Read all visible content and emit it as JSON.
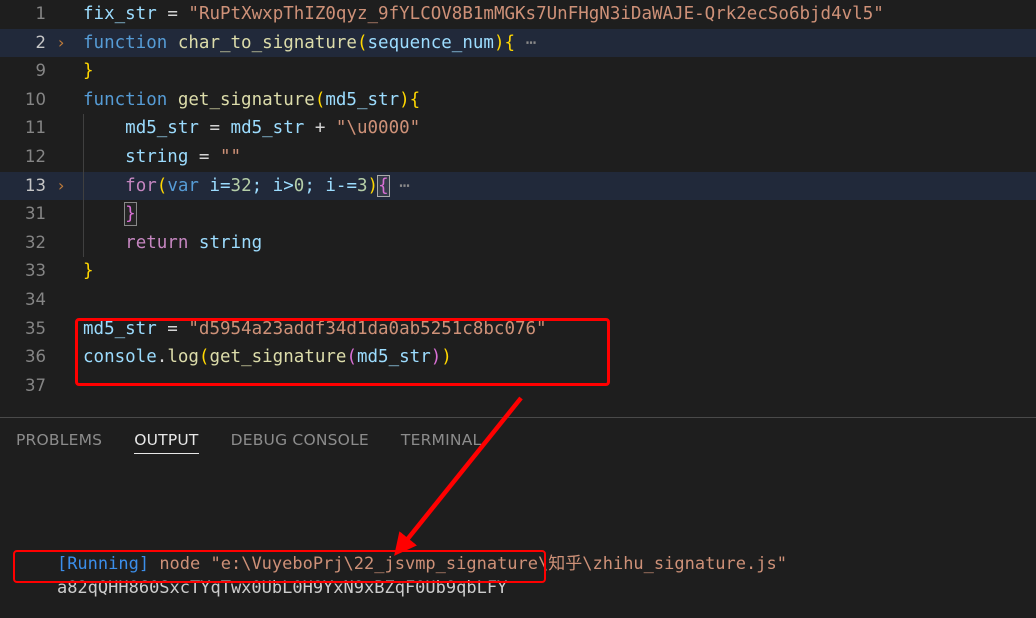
{
  "editor": {
    "lines": [
      {
        "number": "1",
        "fold": "",
        "active": false,
        "indent": 0,
        "tokens": [
          {
            "t": "fix_str",
            "c": "t-var"
          },
          {
            "t": " ",
            "c": "t-plain"
          },
          {
            "t": "=",
            "c": "t-punct"
          },
          {
            "t": " ",
            "c": "t-plain"
          },
          {
            "t": "\"RuPtXwxpThIZ0qyz_9fYLCOV8B1mMGKs7UnFHgN3iDaWAJE-Qrk2ecSo6bjd4vl5\"",
            "c": "t-str"
          }
        ]
      },
      {
        "number": "2",
        "fold": "chevron-right-icon",
        "active": true,
        "indent": 0,
        "tokens": [
          {
            "t": "function",
            "c": "t-kw"
          },
          {
            "t": " ",
            "c": "t-plain"
          },
          {
            "t": "char_to_signature",
            "c": "t-fn"
          },
          {
            "t": "(",
            "c": "t-paren1"
          },
          {
            "t": "sequence_num",
            "c": "t-var"
          },
          {
            "t": ")",
            "c": "t-paren1"
          },
          {
            "t": "{",
            "c": "t-paren1"
          },
          {
            "t": " ⋯",
            "c": "t-dots"
          }
        ]
      },
      {
        "number": "9",
        "fold": "",
        "active": false,
        "indent": 0,
        "tokens": [
          {
            "t": "}",
            "c": "t-paren1"
          }
        ]
      },
      {
        "number": "10",
        "fold": "",
        "active": false,
        "indent": 0,
        "tokens": [
          {
            "t": "function",
            "c": "t-kw"
          },
          {
            "t": " ",
            "c": "t-plain"
          },
          {
            "t": "get_signature",
            "c": "t-fn"
          },
          {
            "t": "(",
            "c": "t-paren1"
          },
          {
            "t": "md5_str",
            "c": "t-var"
          },
          {
            "t": ")",
            "c": "t-paren1"
          },
          {
            "t": "{",
            "c": "t-paren1"
          }
        ]
      },
      {
        "number": "11",
        "fold": "",
        "active": false,
        "indent": 1,
        "tokens": [
          {
            "t": "    ",
            "c": "t-plain"
          },
          {
            "t": "md5_str",
            "c": "t-var"
          },
          {
            "t": " = ",
            "c": "t-punct"
          },
          {
            "t": "md5_str",
            "c": "t-var"
          },
          {
            "t": " + ",
            "c": "t-punct"
          },
          {
            "t": "\"\\u0000\"",
            "c": "t-str"
          }
        ]
      },
      {
        "number": "12",
        "fold": "",
        "active": false,
        "indent": 1,
        "tokens": [
          {
            "t": "    ",
            "c": "t-plain"
          },
          {
            "t": "string",
            "c": "t-var"
          },
          {
            "t": " = ",
            "c": "t-punct"
          },
          {
            "t": "\"\"",
            "c": "t-str"
          }
        ]
      },
      {
        "number": "13",
        "fold": "chevron-right-icon",
        "active": true,
        "indent": 1,
        "tokens": [
          {
            "t": "    ",
            "c": "t-plain"
          },
          {
            "t": "for",
            "c": "t-kw2"
          },
          {
            "t": "(",
            "c": "t-paren1"
          },
          {
            "t": "var",
            "c": "t-kw"
          },
          {
            "t": " i=",
            "c": "t-var"
          },
          {
            "t": "32",
            "c": "t-num"
          },
          {
            "t": "; i>",
            "c": "t-var"
          },
          {
            "t": "0",
            "c": "t-num"
          },
          {
            "t": "; i-=",
            "c": "t-var"
          },
          {
            "t": "3",
            "c": "t-num"
          },
          {
            "t": ")",
            "c": "t-paren1"
          },
          {
            "t": "{",
            "c": "t-paren2",
            "box": "cursor"
          },
          {
            "t": " ⋯",
            "c": "t-dots"
          }
        ]
      },
      {
        "number": "31",
        "fold": "",
        "active": false,
        "indent": 1,
        "tokens": [
          {
            "t": "    ",
            "c": "t-plain"
          },
          {
            "t": "}",
            "c": "t-paren2",
            "box": "bracket"
          }
        ]
      },
      {
        "number": "32",
        "fold": "",
        "active": false,
        "indent": 1,
        "tokens": [
          {
            "t": "    ",
            "c": "t-plain"
          },
          {
            "t": "return",
            "c": "t-kw2"
          },
          {
            "t": " ",
            "c": "t-plain"
          },
          {
            "t": "string",
            "c": "t-var"
          }
        ]
      },
      {
        "number": "33",
        "fold": "",
        "active": false,
        "indent": 0,
        "tokens": [
          {
            "t": "}",
            "c": "t-paren1"
          }
        ]
      },
      {
        "number": "34",
        "fold": "",
        "active": false,
        "indent": 0,
        "tokens": []
      },
      {
        "number": "35",
        "fold": "",
        "active": false,
        "indent": 0,
        "tokens": [
          {
            "t": "md5_str",
            "c": "t-var"
          },
          {
            "t": " = ",
            "c": "t-punct"
          },
          {
            "t": "\"d5954a23addf34d1da0ab5251c8bc076\"",
            "c": "t-str"
          }
        ]
      },
      {
        "number": "36",
        "fold": "",
        "active": false,
        "indent": 0,
        "tokens": [
          {
            "t": "console",
            "c": "t-obj"
          },
          {
            "t": ".",
            "c": "t-punct"
          },
          {
            "t": "log",
            "c": "t-prop"
          },
          {
            "t": "(",
            "c": "t-paren1"
          },
          {
            "t": "get_signature",
            "c": "t-fn"
          },
          {
            "t": "(",
            "c": "t-paren2"
          },
          {
            "t": "md5_str",
            "c": "t-var"
          },
          {
            "t": ")",
            "c": "t-paren2"
          },
          {
            "t": ")",
            "c": "t-paren1"
          }
        ]
      },
      {
        "number": "37",
        "fold": "",
        "active": false,
        "indent": 0,
        "tokens": []
      }
    ]
  },
  "panel": {
    "tabs": [
      {
        "label": "PROBLEMS",
        "active": false
      },
      {
        "label": "OUTPUT",
        "active": true
      },
      {
        "label": "DEBUG CONSOLE",
        "active": false
      },
      {
        "label": "TERMINAL",
        "active": false
      }
    ],
    "terminal": {
      "running_tag": "[Running]",
      "command": " node ",
      "path": "\"e:\\VuyeboPrj\\22_jsvmp_signature\\知乎\\zhihu_signature.js\"",
      "result": "a82qQHH860SxcTYqTwx0UbL0H9YxN9xBZqF0Ub9qbLFY"
    }
  },
  "annotations": {
    "color": "#ff0000",
    "code_box_label": "red-rectangle-around-lines-35-36",
    "output_box_label": "red-rectangle-around-signature-output",
    "arrow_label": "red-arrow-from-code-to-output"
  }
}
